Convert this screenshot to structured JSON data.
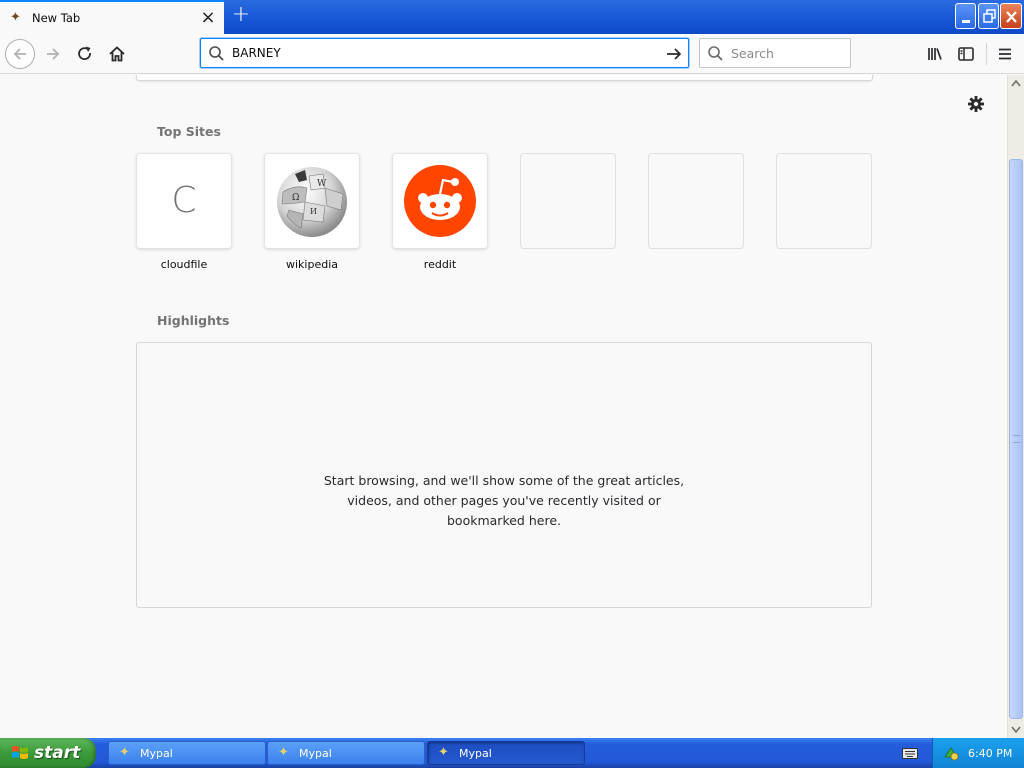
{
  "browser": {
    "tab": {
      "title": "New Tab",
      "favicon": "mypal-icon",
      "close_icon": "close-icon"
    },
    "new_tab_icon": "plus-icon",
    "window_controls": [
      "minimize-icon",
      "restore-icon",
      "close-icon"
    ],
    "url_bar": {
      "value": "BARNEY",
      "icon": "search-icon",
      "go_icon": "arrow-right-icon"
    },
    "search_bar": {
      "placeholder": "Search",
      "icon": "search-icon"
    },
    "accent_color": "#0a84ff"
  },
  "newtab": {
    "top_sites_title": "Top Sites",
    "highlights_title": "Highlights",
    "top_sites": [
      {
        "label": "cloudfile",
        "letter": "C",
        "type": "letter"
      },
      {
        "label": "wikipedia",
        "type": "wikipedia-globe"
      },
      {
        "label": "reddit",
        "type": "reddit-logo",
        "color": "#ff4500"
      },
      {
        "label": "",
        "type": "empty"
      },
      {
        "label": "",
        "type": "empty"
      },
      {
        "label": "",
        "type": "empty"
      }
    ],
    "highlights_empty_lines": [
      "Start browsing, and we'll show some of the great articles,",
      "videos, and other pages you've recently visited or",
      "bookmarked here."
    ]
  },
  "taskbar": {
    "start_label": "start",
    "tasks": [
      {
        "label": "Mypal",
        "active": false
      },
      {
        "label": "Mypal",
        "active": false
      },
      {
        "label": "Mypal",
        "active": true
      }
    ],
    "clock": "6:40 PM"
  }
}
